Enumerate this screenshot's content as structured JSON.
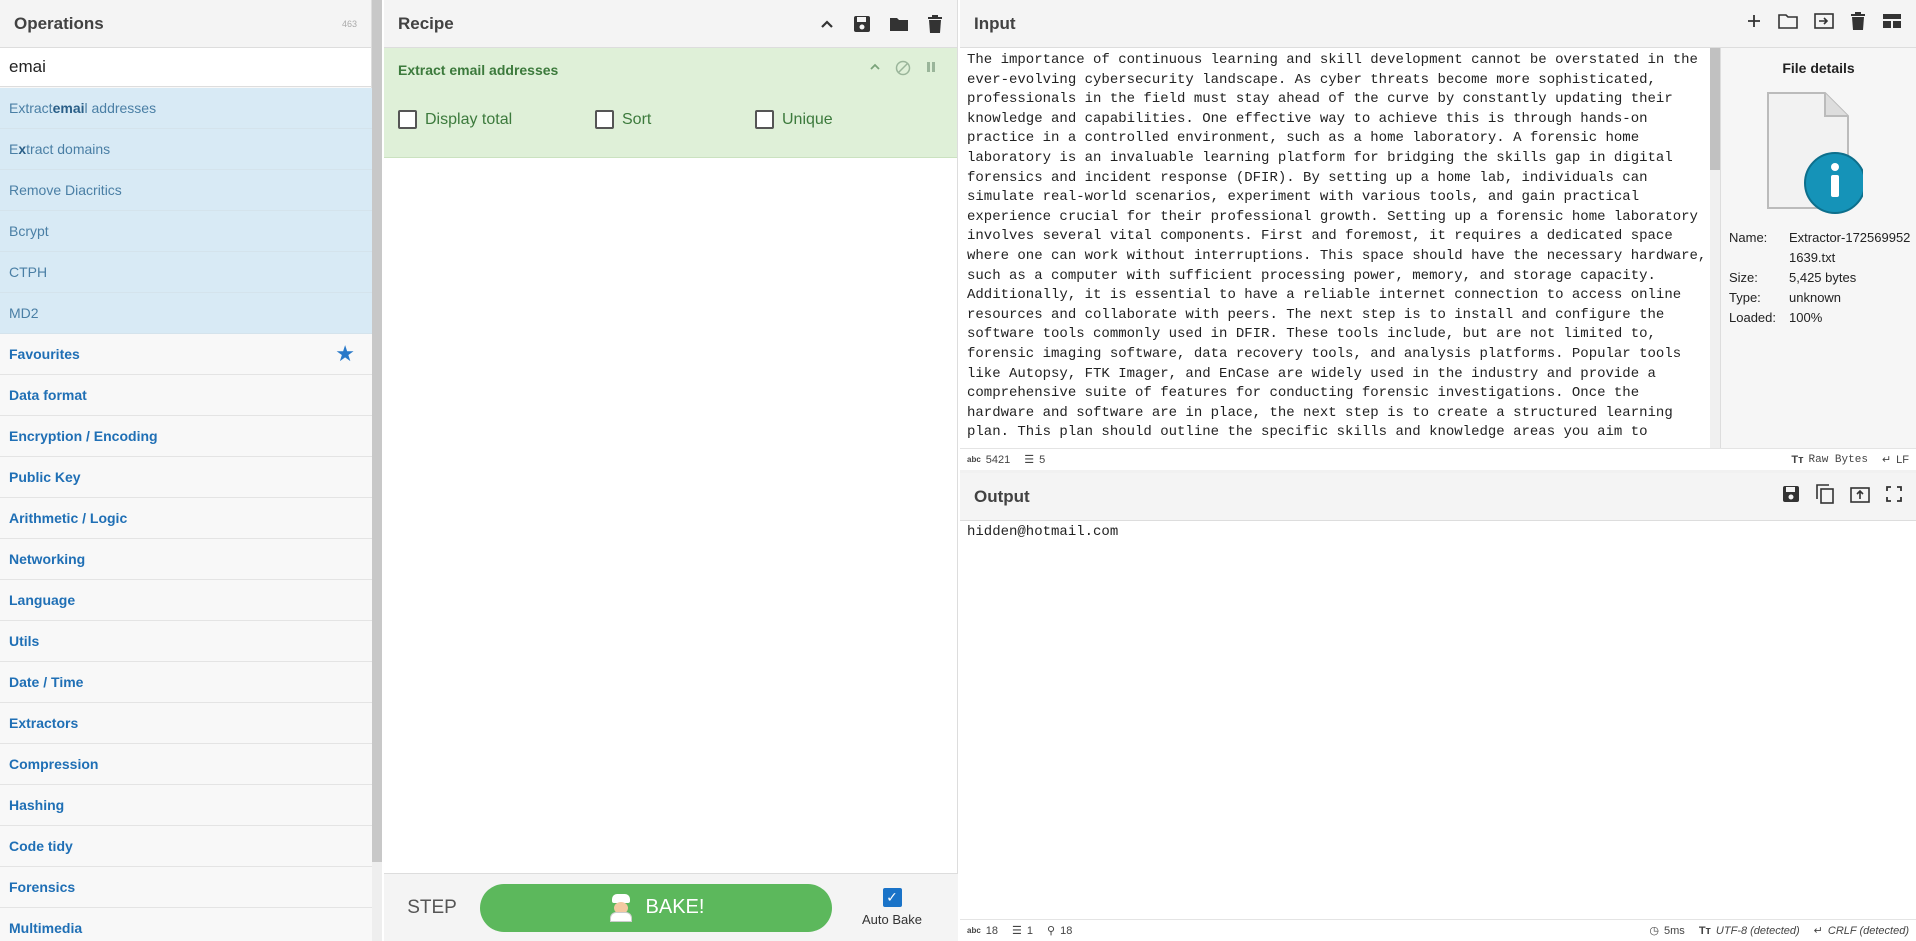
{
  "operations": {
    "title": "Operations",
    "count": "463",
    "search_value": "emai",
    "results": [
      {
        "pre": "Extract ",
        "hl": "emai",
        "post": "l addresses"
      },
      {
        "pre": "E",
        "hl": "x",
        "post": "tract domains"
      },
      {
        "pre": "Remove Diacritics",
        "hl": "",
        "post": ""
      },
      {
        "pre": "Bcrypt",
        "hl": "",
        "post": ""
      },
      {
        "pre": "CTPH",
        "hl": "",
        "post": ""
      },
      {
        "pre": "MD2",
        "hl": "",
        "post": ""
      }
    ],
    "categories": [
      "Favourites",
      "Data format",
      "Encryption / Encoding",
      "Public Key",
      "Arithmetic / Logic",
      "Networking",
      "Language",
      "Utils",
      "Date / Time",
      "Extractors",
      "Compression",
      "Hashing",
      "Code tidy",
      "Forensics",
      "Multimedia"
    ]
  },
  "recipe": {
    "title": "Recipe",
    "operation_title": "Extract email addresses",
    "options": [
      "Display total",
      "Sort",
      "Unique"
    ],
    "step_label": "STEP",
    "bake_label": "BAKE!",
    "autobake_label": "Auto Bake"
  },
  "input": {
    "title": "Input",
    "text": "The importance of continuous learning and skill development cannot be overstated in the ever-evolving cybersecurity landscape. As cyber threats become more sophisticated, professionals in the field must stay ahead of the curve by constantly updating their knowledge and capabilities. One effective way to achieve this is through hands-on practice in a controlled environment, such as a home laboratory. A forensic home laboratory is an invaluable learning platform for bridging the skills gap in digital forensics and incident response (DFIR). By setting up a home lab, individuals can simulate real-world scenarios, experiment with various tools, and gain practical experience crucial for their professional growth. Setting up a forensic home laboratory involves several vital components. First and foremost, it requires a dedicated space where one can work without interruptions. This space should have the necessary hardware, such as a computer with sufficient processing power, memory, and storage capacity.\nAdditionally, it is essential to have a reliable internet connection to access online resources and collaborate with peers. The next step is to install and configure the software tools commonly used in DFIR. These tools include, but are not limited to, forensic imaging software, data recovery tools, and analysis platforms. Popular tools like Autopsy, FTK Imager, and EnCase are widely used in the industry and provide a comprehensive suite of features for conducting forensic investigations. Once the hardware and software are in place, the next step is to create a structured learning plan. This plan should outline the specific skills and knowledge areas you aim to",
    "status": {
      "chars": "5421",
      "lines": "5",
      "format": "Raw Bytes",
      "eol": "LF"
    }
  },
  "file_details": {
    "title": "File details",
    "rows": [
      {
        "k": "Name:",
        "v": "Extractor-1725699521639.txt"
      },
      {
        "k": "Size:",
        "v": "5,425 bytes"
      },
      {
        "k": "Type:",
        "v": "unknown"
      },
      {
        "k": "Loaded:",
        "v": "100%"
      }
    ]
  },
  "output": {
    "title": "Output",
    "text": "hidden@hotmail.com",
    "status": {
      "chars": "18",
      "lines": "1",
      "pos": "18",
      "time": "5ms",
      "encoding": "UTF-8 (detected)",
      "eol": "CRLF (detected)"
    }
  }
}
